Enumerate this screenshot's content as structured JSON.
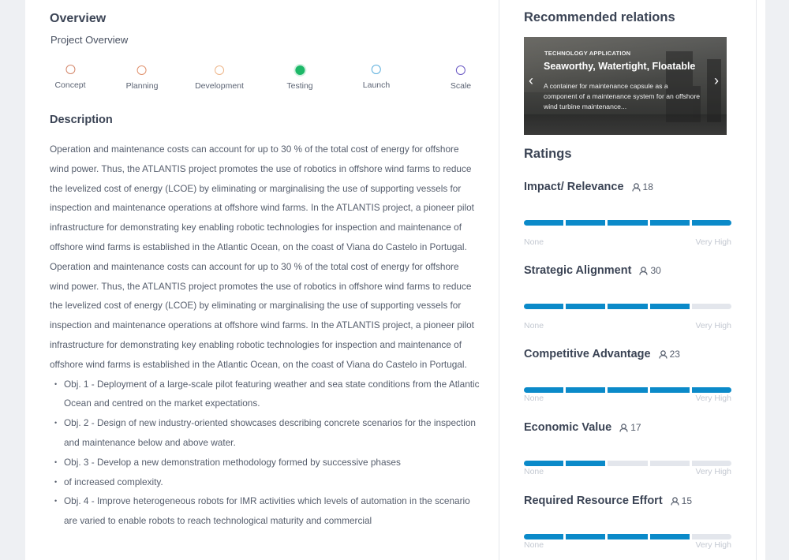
{
  "overview": {
    "title": "Overview",
    "subtitle": "Project Overview",
    "stages": [
      {
        "label": "Concept",
        "color": "#d4876b",
        "active": false
      },
      {
        "label": "Planning",
        "color": "#e0916d",
        "active": false
      },
      {
        "label": "Development",
        "color": "#eeb68a",
        "active": false
      },
      {
        "label": "Testing",
        "color": "#1db868",
        "active": true
      },
      {
        "label": "Launch",
        "color": "#5aaedc",
        "active": false
      },
      {
        "label": "Scale",
        "color": "#6b59c4",
        "active": false
      }
    ]
  },
  "description": {
    "title": "Description",
    "paragraphs": [
      "Operation and maintenance costs can account for up to 30 % of the total cost of energy for offshore wind power. Thus, the ATLANTIS project promotes the use of robotics in offshore wind farms to reduce the levelized cost of energy (LCOE) by eliminating or marginalising the use of supporting vessels for inspection and maintenance operations at offshore wind farms. In the ATLANTIS project, a pioneer pilot infrastructure for demonstrating key enabling robotic technologies for inspection and maintenance of offshore wind farms is established in the Atlantic Ocean, on the coast of Viana do Castelo in Portugal.",
      "Operation and maintenance costs can account for up to 30 % of the total cost of energy for offshore wind power. Thus, the ATLANTIS project promotes the use of robotics in offshore wind farms to reduce the levelized cost of energy (LCOE) by eliminating or marginalising the use of supporting vessels for inspection and maintenance operations at offshore wind farms. In the ATLANTIS project, a pioneer pilot infrastructure for demonstrating key enabling robotic technologies for inspection and maintenance of offshore wind farms is established in the Atlantic Ocean, on the coast of Viana do Castelo in Portugal."
    ],
    "objectives": [
      "Obj. 1 - Deployment of a large-scale pilot featuring weather and sea state conditions from the Atlantic Ocean and centred on the market expectations.",
      "Obj. 2 - Design of new industry-oriented showcases describing concrete scenarios for the inspection and maintenance below and above water.",
      "Obj. 3 - Develop a new demonstration methodology formed by successive phases",
      "of increased complexity.",
      "Obj. 4 - Improve heterogeneous robots for IMR activities which levels of automation in the scenario are varied to enable robots to reach technological maturity and commercial"
    ]
  },
  "recommended": {
    "title": "Recommended relations",
    "card": {
      "kicker": "TECHNOLOGY APPLICATION",
      "title": "Seaworthy, Watertight, Floatable",
      "text": "A container for maintenance capsule as a component of a maintenance system for an offshore wind turbine maintenance...",
      "prev_icon": "‹",
      "next_icon": "›"
    }
  },
  "ratings": {
    "title": "Ratings",
    "scale_low": "None",
    "scale_high": "Very High",
    "segments_total": 5,
    "accent": "#0b8ac9",
    "items": [
      {
        "label": "Impact/ Relevance",
        "count": "18",
        "value": 5
      },
      {
        "label": "Strategic Alignment",
        "count": "30",
        "value": 4
      },
      {
        "label": "Competitive Advantage",
        "count": "23",
        "value": 5
      },
      {
        "label": "Economic Value",
        "count": "17",
        "value": 2
      },
      {
        "label": "Required Resource Effort",
        "count": "15",
        "value": 4
      }
    ]
  }
}
